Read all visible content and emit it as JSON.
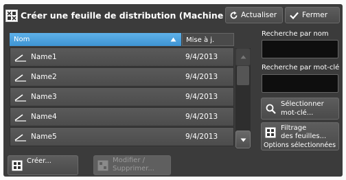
{
  "header": {
    "title": "Créer une feuille de distribution (Machine locale)",
    "refresh_label": "Actualiser",
    "close_label": "Fermer"
  },
  "list": {
    "columns": [
      "Nom",
      "Mise à j."
    ],
    "rows": [
      {
        "name": "Name1",
        "date": "9/4/2013"
      },
      {
        "name": "Name2",
        "date": "9/4/2013"
      },
      {
        "name": "Name3",
        "date": "9/4/2013"
      },
      {
        "name": "Name4",
        "date": "9/4/2013"
      },
      {
        "name": "Name5",
        "date": "9/4/2013"
      }
    ]
  },
  "search": {
    "by_name_label": "Recherche par nom",
    "by_keyword_label": "Recherche par mot-clé",
    "select_keyword_line1": "Sélectionner",
    "select_keyword_line2": "mot-clé..."
  },
  "filter": {
    "line1": "Filtrage",
    "line2": "des feuilles...",
    "status": "Options sélectionnées"
  },
  "footer": {
    "create_label": "Créer...",
    "modify_line1": "Modifier /",
    "modify_line2": "Supprimer..."
  },
  "colors": {
    "panel": "#3b3b3b",
    "header_accent": "#3f94d3"
  }
}
